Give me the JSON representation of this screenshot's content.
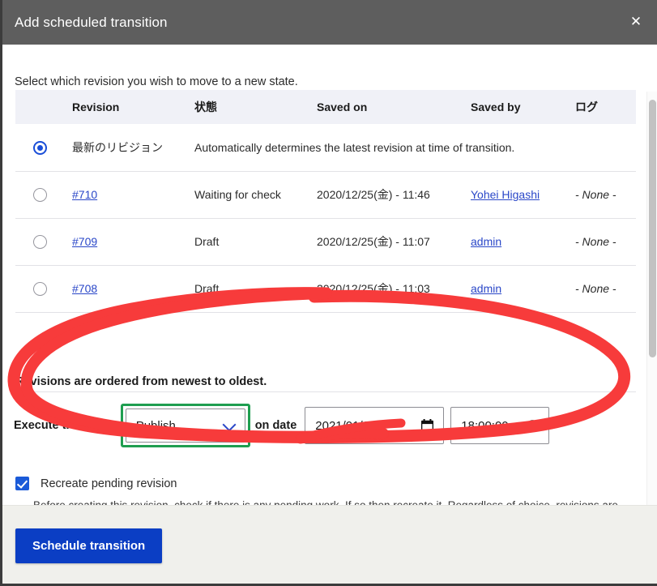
{
  "dialog": {
    "title": "Add scheduled transition",
    "close_icon": "close-icon",
    "intro": "Select which revision you wish to move to a new state.",
    "ordered_note": "Revisions are ordered from newest to oldest."
  },
  "table": {
    "headers": [
      "",
      "Revision",
      "状態",
      "Saved on",
      "Saved by",
      "ログ"
    ],
    "rows": [
      {
        "selected": true,
        "revision": "最新のリビジョン",
        "state": "Automatically determines the latest revision at time of transition.",
        "saved_on": "",
        "saved_by": "",
        "log": "",
        "spanned": true
      },
      {
        "selected": false,
        "revision": "#710",
        "state": "Waiting for check",
        "saved_on": "2020/12/25(金) - 11:46",
        "saved_by": "Yohei Higashi",
        "log": "- None -",
        "spanned": false
      },
      {
        "selected": false,
        "revision": "#709",
        "state": "Draft",
        "saved_on": "2020/12/25(金) - 11:07",
        "saved_by": "admin",
        "log": "- None -",
        "spanned": false
      },
      {
        "selected": false,
        "revision": "#708",
        "state": "Draft",
        "saved_on": "2020/12/25(金) - 11:03",
        "saved_by": "admin",
        "log": "- None -",
        "spanned": false
      }
    ]
  },
  "transition": {
    "label_before": "Execute transition",
    "state_value": "Publish",
    "state_options": [
      "Publish"
    ],
    "chevron_icon": "chevron-down-icon",
    "label_between": "on date",
    "date_value": "2021/01/08",
    "date_icon": "calendar-icon",
    "time_value": "18:00:00",
    "time_icon": "clock-icon"
  },
  "recreate": {
    "checked": true,
    "label": "Recreate pending revision",
    "description": "Before creating this revision, check if there is any pending work. If so then recreate it. Regardless of choice, revisions are safely retained in history, and can be reverted manually."
  },
  "footer": {
    "submit_label": "Schedule transition"
  },
  "colors": {
    "titlebar": "#5e5e5e",
    "primary_button": "#0b3ec4",
    "link": "#2a47c8",
    "radio_selected": "#1a4ed8",
    "checkbox": "#1a5ad8",
    "highlight_green": "#1f9e50",
    "annotation_red": "#f73b3b",
    "table_header_bg": "#f0f1f7",
    "footer_bg": "#f0f0ec"
  }
}
